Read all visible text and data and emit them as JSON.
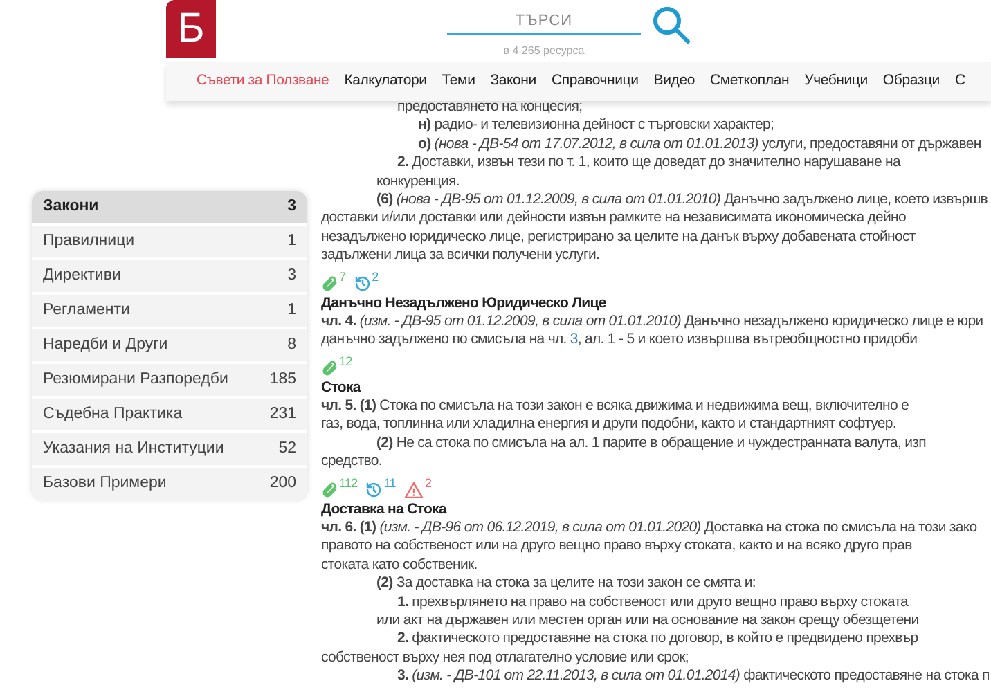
{
  "header": {
    "logo": "Б",
    "search": {
      "placeholder": "ТЪРСИ"
    },
    "resource_count": "в 4 265 ресурса"
  },
  "nav": [
    {
      "label": "Съвети за Ползване",
      "selected": true
    },
    {
      "label": "Калкулатори",
      "selected": false
    },
    {
      "label": "Теми",
      "selected": false
    },
    {
      "label": "Закони",
      "selected": false
    },
    {
      "label": "Справочници",
      "selected": false
    },
    {
      "label": "Видео",
      "selected": false
    },
    {
      "label": "Сметкоплан",
      "selected": false
    },
    {
      "label": "Учебници",
      "selected": false
    },
    {
      "label": "Образци",
      "selected": false
    },
    {
      "label": "С",
      "selected": false
    }
  ],
  "sidebar": [
    {
      "label": "Закони",
      "count": "3",
      "selected": true
    },
    {
      "label": "Правилници",
      "count": "1",
      "selected": false
    },
    {
      "label": "Директиви",
      "count": "3",
      "selected": false
    },
    {
      "label": "Регламенти",
      "count": "1",
      "selected": false
    },
    {
      "label": "Наредби и Други",
      "count": "8",
      "selected": false
    },
    {
      "label": "Резюмирани Разпоредби",
      "count": "185",
      "selected": false
    },
    {
      "label": "Съдебна Практика",
      "count": "231",
      "selected": false
    },
    {
      "label": "Указания на Институции",
      "count": "52",
      "selected": false
    },
    {
      "label": "Базови Примери",
      "count": "200",
      "selected": false
    }
  ],
  "content": [
    {
      "kind": "clause",
      "text": "предоставянето на концесия;"
    },
    {
      "kind": "point",
      "text": "**н)** радио- и телевизионна дейност с търговски характер;"
    },
    {
      "kind": "point",
      "text": "**о)** *(нова - ДВ-54 от 17.07.2012, в сила от 01.01.2013)* услуги, предоставяни от държавен"
    },
    {
      "kind": "clause",
      "text": "**2.** Доставки, извън тези по т. 1, които ще доведат до значително нарушаване на"
    },
    {
      "kind": "para",
      "text": "конкуренция."
    },
    {
      "kind": "para",
      "text": "**(6)** *(нова - ДВ-95 от 01.12.2009, в сила от 01.01.2010)* Данъчно задължено лице, което извършв"
    },
    {
      "kind": "plain",
      "text": "доставки и/или доставки или дейности извън рамките на независимата икономическа дейно"
    },
    {
      "kind": "plain",
      "text": "незадължено юридическо лице, регистрирано за целите на данък върху добавената стойност"
    },
    {
      "kind": "plain",
      "text": "задължени лица за всички получени услуги."
    },
    {
      "kind": "badges",
      "items": [
        {
          "kind": "attachments",
          "count": "7"
        },
        {
          "kind": "history",
          "count": "2"
        }
      ]
    },
    {
      "kind": "heading",
      "text": "Данъчно Незадължено Юридическо Лице"
    },
    {
      "kind": "plain",
      "text": "**чл. 4.** *(изм. - ДВ-95 от 01.12.2009, в сила от 01.01.2010)* Данъчно незадължено юридическо лице е юри"
    },
    {
      "kind": "linked",
      "before": "данъчно задължено по смисъла на чл.",
      "link": "3",
      "after": ", ал. 1 - 5 и което извършва вътреобщностно придоби"
    },
    {
      "kind": "badges",
      "items": [
        {
          "kind": "attachments",
          "count": "12"
        }
      ]
    },
    {
      "kind": "heading",
      "text": "Стока"
    },
    {
      "kind": "plain",
      "text": "**чл. 5. (1)** Стока по смисъла на този закон е всяка движима и недвижима вещ, включително е"
    },
    {
      "kind": "plain",
      "text": "газ, вода, топлинна или хладилна енергия и други подобни, както и стандартният софтуер."
    },
    {
      "kind": "para",
      "text": "**(2)** Не са стока по смисъла на ал. 1 парите в обращение и чуждестранната валута, изп"
    },
    {
      "kind": "plain",
      "text": "средство."
    },
    {
      "kind": "badges",
      "items": [
        {
          "kind": "attachments",
          "count": "112"
        },
        {
          "kind": "history",
          "count": "11"
        },
        {
          "kind": "warnings",
          "count": "2"
        }
      ]
    },
    {
      "kind": "heading",
      "text": "Доставка на Стока"
    },
    {
      "kind": "plain",
      "text": "**чл. 6. (1)** *(изм. - ДВ-96 от 06.12.2019, в сила от 01.01.2020)* Доставка на стока по смисъла на този зако"
    },
    {
      "kind": "plain",
      "text": "правото на собственост или на друго вещно право върху стоката, както и на всяко друго прав"
    },
    {
      "kind": "plain",
      "text": "стоката като собственик."
    },
    {
      "kind": "para",
      "text": "**(2)** За доставка на стока за целите на този закон се смята и:"
    },
    {
      "kind": "clause",
      "text": "**1.** прехвърлянето на право на собственост или друго вещно право върху стоката"
    },
    {
      "kind": "para",
      "text": "или акт на държавен или местен орган или на основание на закон срещу обезщетени"
    },
    {
      "kind": "clause",
      "text": "**2.** фактическото предоставяне на стока по договор, в който е предвидено прехвър"
    },
    {
      "kind": "plain",
      "text": "собственост върху нея под отлагателно условие или срок;"
    },
    {
      "kind": "clause",
      "text": "**3.** *(изм. - ДВ-101 от 22.11.2013, в сила от 01.01.2014)* фактическото предоставяне на стока п"
    }
  ]
}
